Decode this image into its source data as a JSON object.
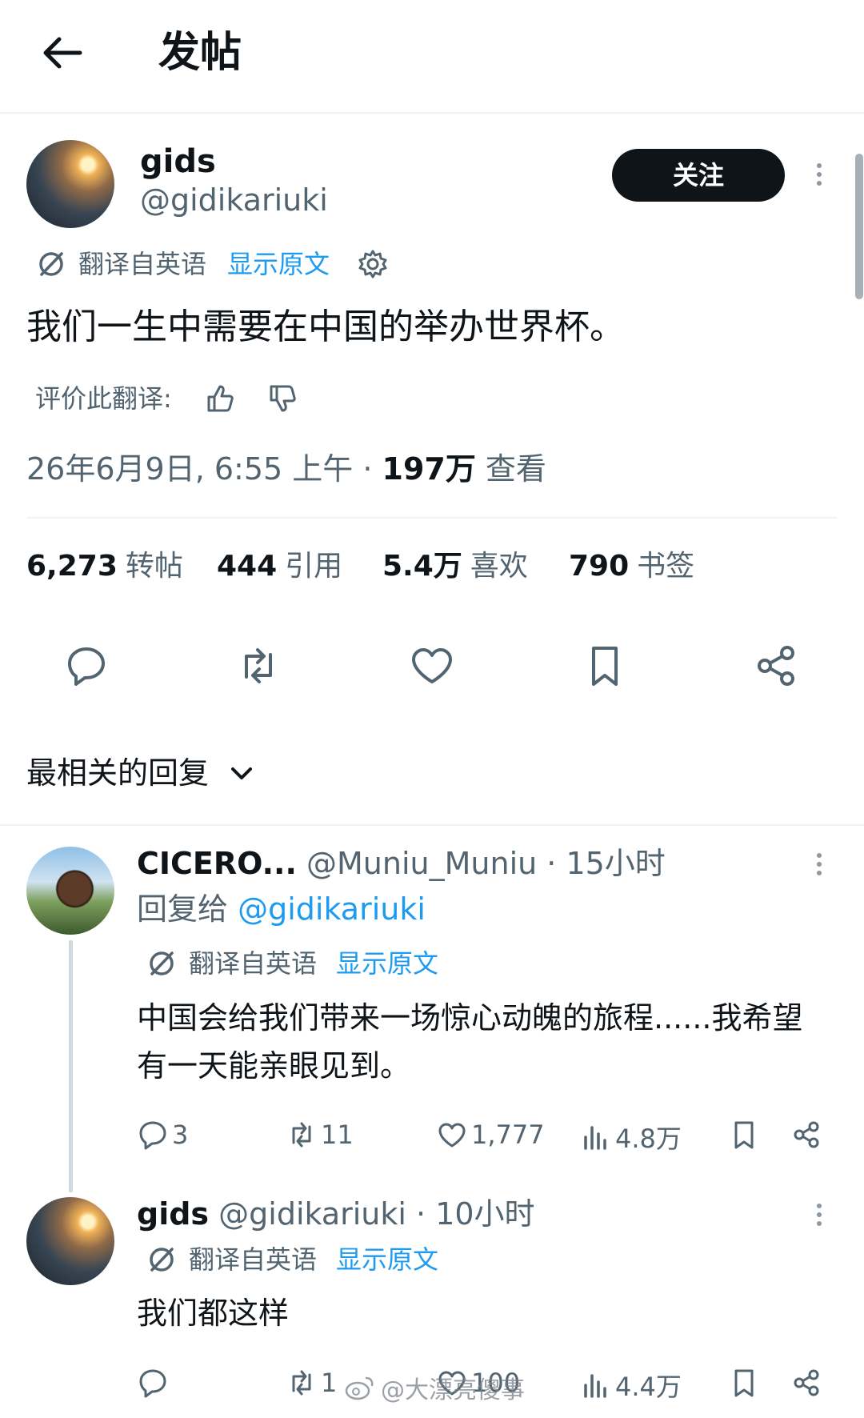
{
  "header": {
    "title": "发帖"
  },
  "post": {
    "display_name": "gids",
    "handle": "@gidikariuki",
    "follow_label": "关注",
    "translated_from": "翻译自英语",
    "show_original": "显示原文",
    "text": "我们一生中需要在中国的举办世界杯。",
    "rate_translation": "评价此翻译:",
    "timestamp": "26年6月9日, 6:55 上午 · ",
    "views_count": "197万",
    "views_label": " 查看",
    "stats": [
      {
        "count": "6,273",
        "label": "转帖"
      },
      {
        "count": "444",
        "label": "引用"
      },
      {
        "count": "5.4万",
        "label": "喜欢"
      },
      {
        "count": "790",
        "label": "书签"
      }
    ]
  },
  "replies_filter": {
    "label": "最相关的回复"
  },
  "replies": [
    {
      "display_name": "CICERO...",
      "handle": "@Muniu_Muniu",
      "time": " · 15小时",
      "reply_to_prefix": "回复给 ",
      "reply_to_handle": "@gidikariuki",
      "translated_from": "翻译自英语",
      "show_original": "显示原文",
      "text": "中国会给我们带来一场惊心动魄的旅程......我希望有一天能亲眼见到。",
      "replies": "3",
      "reposts": "11",
      "likes": "1,777",
      "views": "4.8万"
    },
    {
      "display_name": "gids",
      "handle": "@gidikariuki",
      "time": " · 10小时",
      "translated_from": "翻译自英语",
      "show_original": "显示原文",
      "text": "我们都这样",
      "replies": "",
      "reposts": "1",
      "likes": "100",
      "views": "4.4万"
    }
  ],
  "watermark": "@大漂亮傻事",
  "colors": {
    "accent": "#1d9bf0",
    "text": "#0f1419",
    "muted": "#536471",
    "divider": "#eff3f4"
  }
}
